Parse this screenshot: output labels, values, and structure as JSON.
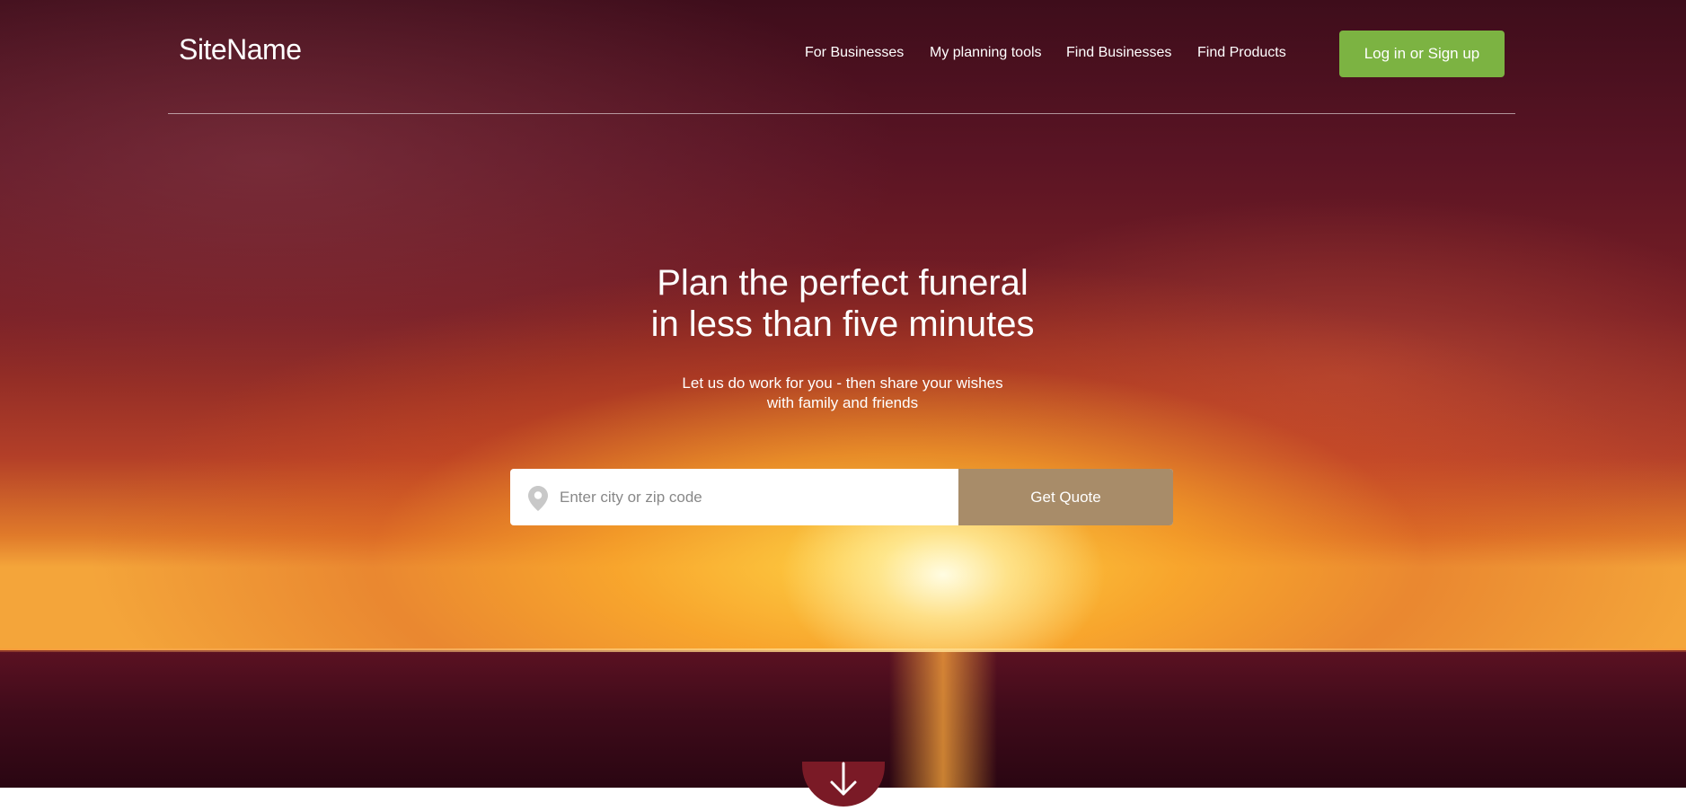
{
  "header": {
    "logo_text": "SiteName",
    "nav": [
      {
        "label": "For Businesses"
      },
      {
        "label": "My planning tools"
      },
      {
        "label": "Find Businesses"
      },
      {
        "label": "Find Products"
      }
    ],
    "login_label": "Log in or Sign up"
  },
  "hero": {
    "headline_line1": "Plan the perfect funeral",
    "headline_line2": "in less than five minutes",
    "subtitle_line1": "Let us do work for you - then share your wishes",
    "subtitle_line2": "with family and friends"
  },
  "search": {
    "placeholder": "Enter city or zip code",
    "value": "",
    "button_label": "Get Quote",
    "location_icon": "map-pin-icon"
  },
  "scroll": {
    "icon": "arrow-down-icon"
  },
  "colors": {
    "login_button": "#7cb342",
    "quote_button": "#a88c69",
    "text": "#ffffff"
  }
}
